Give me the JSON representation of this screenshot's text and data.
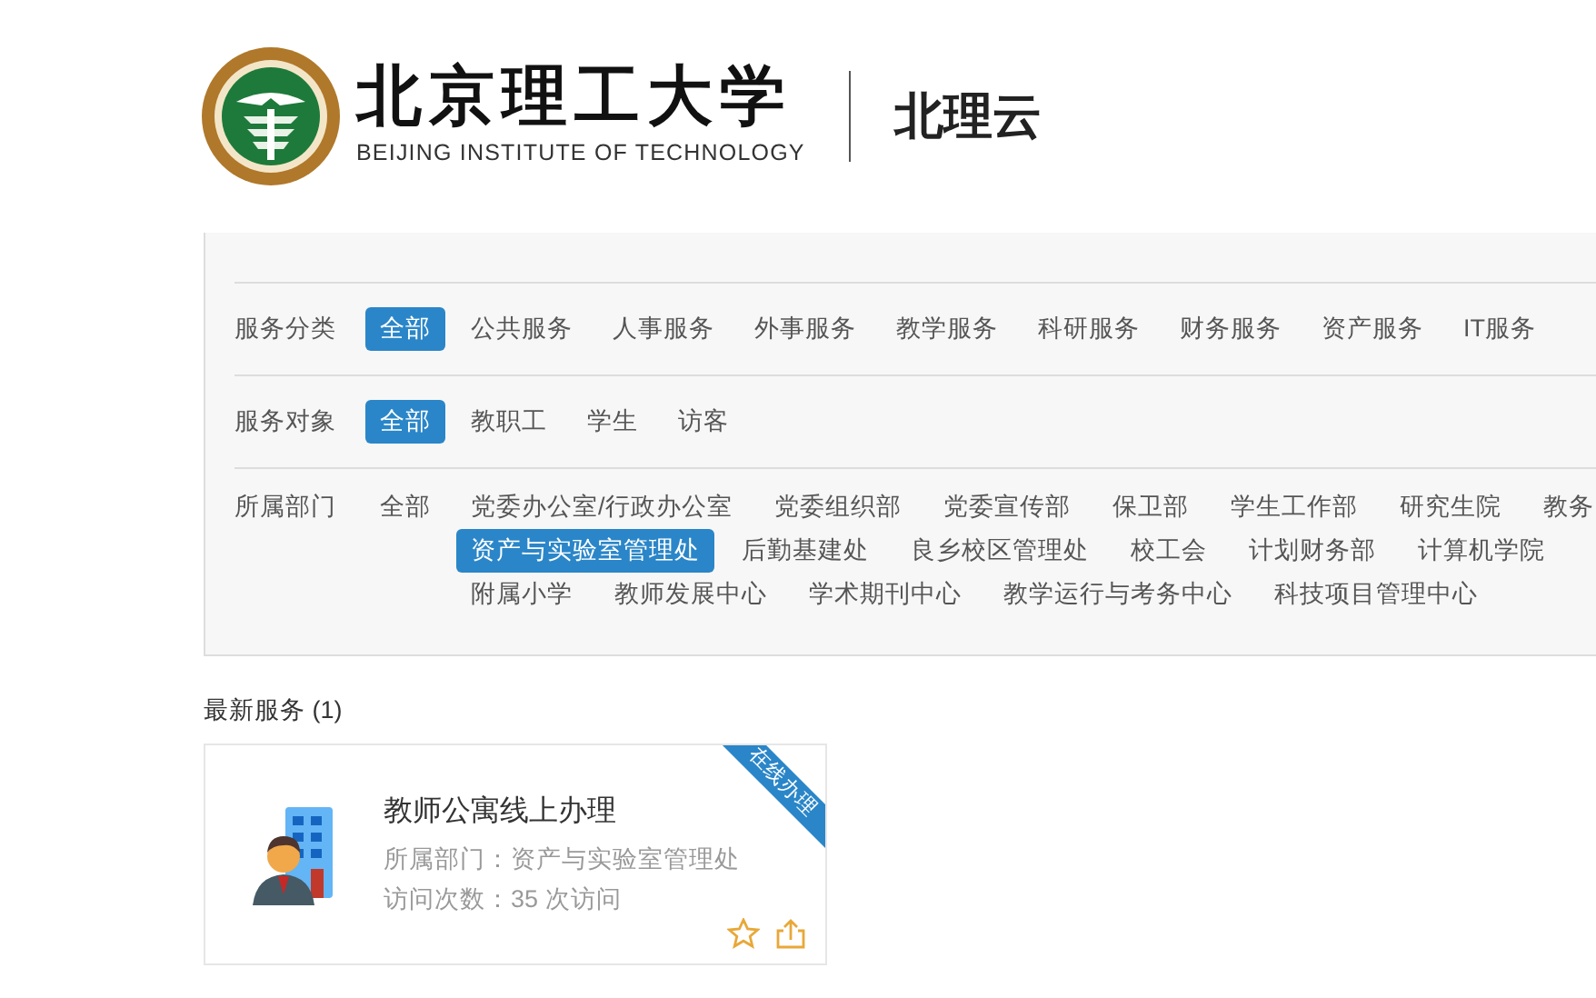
{
  "header": {
    "logo_cn": "北京理工大学",
    "logo_en": "BEIJING INSTITUTE OF TECHNOLOGY",
    "app_name": "北理云"
  },
  "filters": [
    {
      "kind": "hidden"
    },
    {
      "kind": "single",
      "label": "服务分类",
      "lines": [
        [
          {
            "label": "全部",
            "selected": true
          },
          {
            "label": "公共服务",
            "selected": false
          },
          {
            "label": "人事服务",
            "selected": false
          },
          {
            "label": "外事服务",
            "selected": false
          },
          {
            "label": "教学服务",
            "selected": false
          },
          {
            "label": "科研服务",
            "selected": false
          },
          {
            "label": "财务服务",
            "selected": false
          },
          {
            "label": "资产服务",
            "selected": false
          },
          {
            "label": "IT服务",
            "selected": false
          }
        ]
      ]
    },
    {
      "kind": "single",
      "label": "服务对象",
      "lines": [
        [
          {
            "label": "全部",
            "selected": true
          },
          {
            "label": "教职工",
            "selected": false
          },
          {
            "label": "学生",
            "selected": false
          },
          {
            "label": "访客",
            "selected": false
          }
        ]
      ]
    },
    {
      "kind": "multi",
      "label": "所属部门",
      "lines": [
        [
          {
            "label": "全部",
            "selected": false
          },
          {
            "label": "党委办公室/行政办公室",
            "selected": false
          },
          {
            "label": "党委组织部",
            "selected": false
          },
          {
            "label": "党委宣传部",
            "selected": false
          },
          {
            "label": "保卫部",
            "selected": false
          },
          {
            "label": "学生工作部",
            "selected": false
          },
          {
            "label": "研究生院",
            "selected": false
          },
          {
            "label": "教务",
            "selected": false
          }
        ],
        [
          {
            "label": "资产与实验室管理处",
            "selected": true
          },
          {
            "label": "后勤基建处",
            "selected": false
          },
          {
            "label": "良乡校区管理处",
            "selected": false
          },
          {
            "label": "校工会",
            "selected": false
          },
          {
            "label": "计划财务部",
            "selected": false
          },
          {
            "label": "计算机学院",
            "selected": false
          }
        ],
        [
          {
            "label": "附属小学",
            "selected": false
          },
          {
            "label": "教师发展中心",
            "selected": false
          },
          {
            "label": "学术期刊中心",
            "selected": false
          },
          {
            "label": "教学运行与考务中心",
            "selected": false
          },
          {
            "label": "科技项目管理中心",
            "selected": false
          }
        ]
      ]
    }
  ],
  "section_title": "最新服务 (1)",
  "services": [
    {
      "title": "教师公寓线上办理",
      "ribbon": "在线办理",
      "department": "所属部门：资产与实验室管理处",
      "visits": "访问次数：35 次访问"
    }
  ]
}
